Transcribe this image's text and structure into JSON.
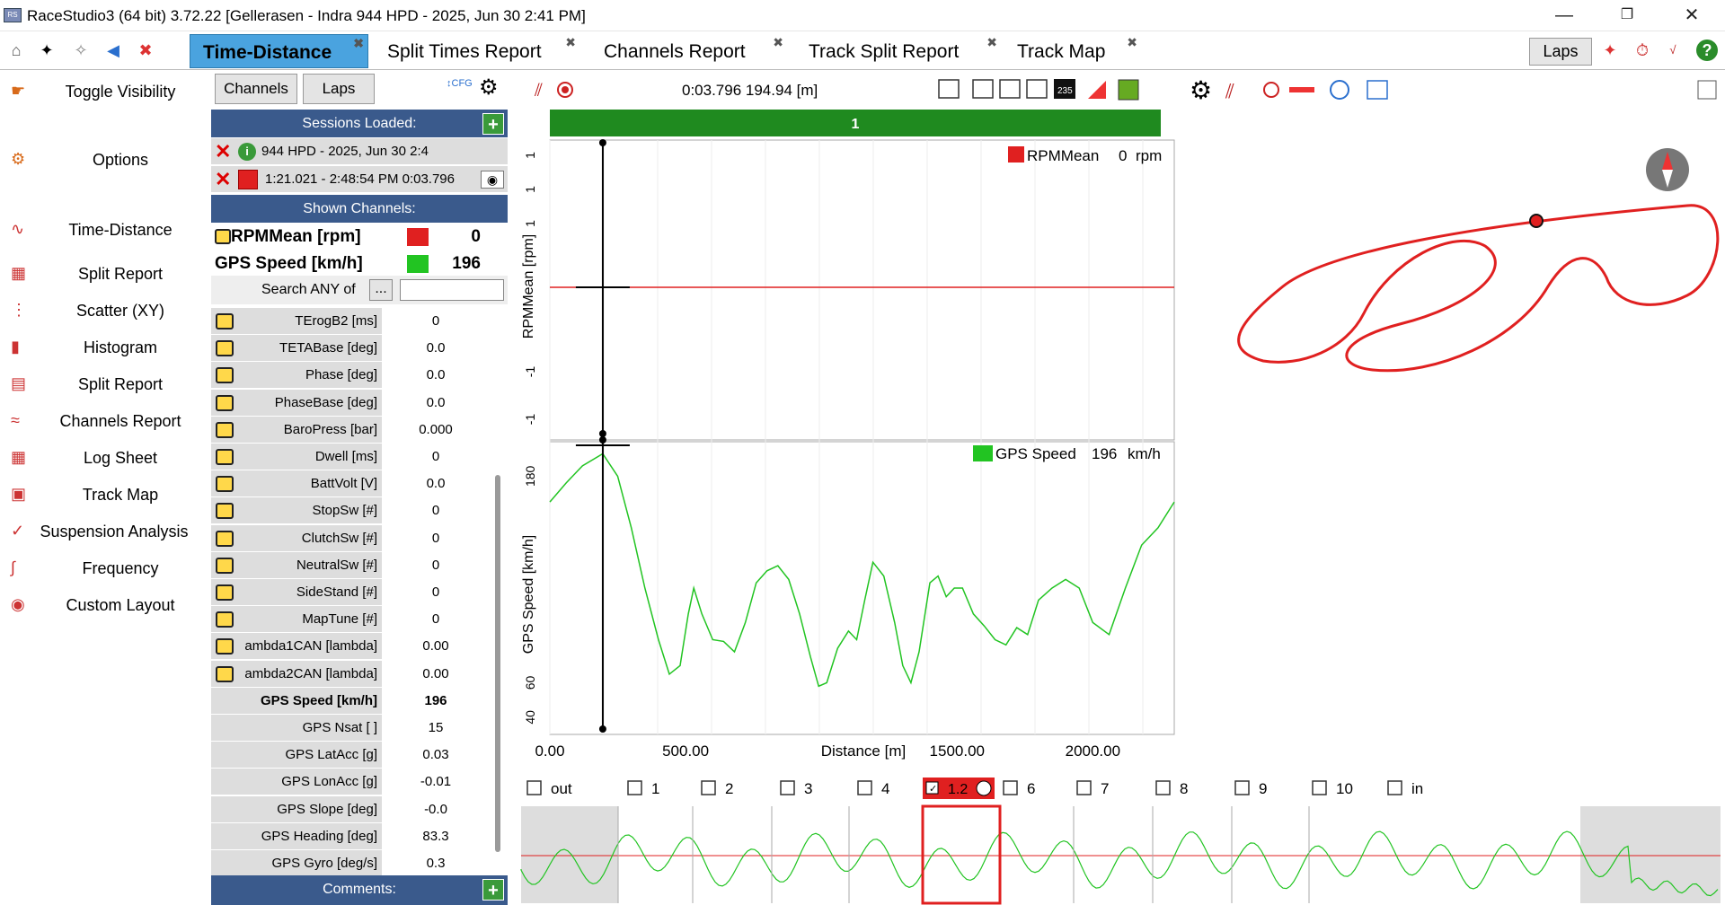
{
  "window": {
    "title": "RaceStudio3 (64 bit) 3.72.22 [Gellerasen - Indra 944 HPD - 2025, Jun 30 2:41 PM]"
  },
  "tabs": [
    {
      "label": "Time-Distance",
      "active": true
    },
    {
      "label": "Split Times Report"
    },
    {
      "label": "Channels Report"
    },
    {
      "label": "Track Split Report"
    },
    {
      "label": "Track Map"
    }
  ],
  "toolbar": {
    "laps_label": "Laps"
  },
  "nav": [
    {
      "label": "Toggle Visibility",
      "icon": "pointer-hand-icon"
    },
    {
      "label": "Options",
      "icon": "gears-icon"
    },
    {
      "label": "Time-Distance",
      "icon": "time-distance-icon"
    },
    {
      "label": "Split Report",
      "icon": "split-report-icon"
    },
    {
      "label": "Scatter (XY)",
      "icon": "scatter-icon"
    },
    {
      "label": "Histogram",
      "icon": "histogram-icon"
    },
    {
      "label": "Split Report",
      "icon": "split-report-2-icon"
    },
    {
      "label": "Channels Report",
      "icon": "channels-report-icon"
    },
    {
      "label": "Log Sheet",
      "icon": "log-sheet-icon"
    },
    {
      "label": "Track Map",
      "icon": "track-map-icon"
    },
    {
      "label": "Suspension Analysis",
      "icon": "suspension-icon"
    },
    {
      "label": "Frequency",
      "icon": "frequency-icon"
    },
    {
      "label": "Custom Layout",
      "icon": "custom-layout-icon"
    }
  ],
  "channels_panel": {
    "channels_btn": "Channels",
    "laps_btn": "Laps",
    "sessions_header": "Sessions Loaded:",
    "session_name": "944 HPD - 2025, Jun 30 2:4",
    "session_lap": "1:21.021 - 2:48:54 PM 0:03.796",
    "shown_header": "Shown Channels:",
    "shown": [
      {
        "name": "RPMMean [rpm]",
        "value": "0",
        "color": "#e02020"
      },
      {
        "name": "GPS Speed [km/h]",
        "value": "196",
        "color": "#22c422"
      }
    ],
    "search_label": "Search ANY of",
    "search_btn": "...",
    "search_value": "",
    "rows": [
      {
        "name": "TErogB2 [ms]",
        "value": "0",
        "note": true
      },
      {
        "name": "TETABase [deg]",
        "value": "0.0",
        "note": true
      },
      {
        "name": "Phase [deg]",
        "value": "0.0",
        "note": true
      },
      {
        "name": "PhaseBase [deg]",
        "value": "0.0",
        "note": true
      },
      {
        "name": "BaroPress [bar]",
        "value": "0.000",
        "note": true
      },
      {
        "name": "Dwell [ms]",
        "value": "0",
        "note": true
      },
      {
        "name": "BattVolt [V]",
        "value": "0.0",
        "note": true
      },
      {
        "name": "StopSw [#]",
        "value": "0",
        "note": true
      },
      {
        "name": "ClutchSw [#]",
        "value": "0",
        "note": true
      },
      {
        "name": "NeutralSw [#]",
        "value": "0",
        "note": true
      },
      {
        "name": "SideStand [#]",
        "value": "0",
        "note": true
      },
      {
        "name": "MapTune [#]",
        "value": "0",
        "note": true
      },
      {
        "name": "ambda1CAN [lambda]",
        "value": "0.00",
        "note": true
      },
      {
        "name": "ambda2CAN [lambda]",
        "value": "0.00",
        "note": true
      },
      {
        "name": "GPS Speed [km/h]",
        "value": "196",
        "note": false,
        "bold": true
      },
      {
        "name": "GPS Nsat [ ]",
        "value": "15",
        "note": false
      },
      {
        "name": "GPS LatAcc [g]",
        "value": "0.03",
        "note": false
      },
      {
        "name": "GPS LonAcc [g]",
        "value": "-0.01",
        "note": false
      },
      {
        "name": "GPS Slope [deg]",
        "value": "-0.0",
        "note": false
      },
      {
        "name": "GPS Heading [deg]",
        "value": "83.3",
        "note": false
      },
      {
        "name": "GPS Gyro [deg/s]",
        "value": "0.3",
        "note": false
      }
    ],
    "comments_header": "Comments:"
  },
  "plot": {
    "cursor_readout": "0:03.796 194.94 [m]",
    "lap_bar_label": "1",
    "top_legend": {
      "name": "RPMMean",
      "value": "0",
      "unit": "rpm",
      "color": "#e02020"
    },
    "bottom_legend": {
      "name": "GPS Speed",
      "value": "196",
      "unit": "km/h",
      "color": "#22c422"
    },
    "top_ylabel": "RPMMean [rpm]",
    "bottom_ylabel": "GPS Speed [km/h]",
    "xlabel": "Distance [m]",
    "top_ticks": [
      "1",
      "1",
      "1",
      "-1",
      "-1"
    ],
    "bottom_ticks": [
      "180",
      "60",
      "40"
    ],
    "x_ticks": [
      "0.00",
      "500.00",
      "1500.00",
      "2000.00"
    ],
    "icon_235": "235"
  },
  "chart_data": {
    "type": "line",
    "xlabel": "Distance [m]",
    "ylabel": "GPS Speed [km/h]",
    "xlim": [
      0,
      2300
    ],
    "ylim": [
      30,
      200
    ],
    "cursor_x": 195,
    "x": [
      0,
      60,
      120,
      195,
      250,
      300,
      350,
      400,
      440,
      480,
      510,
      530,
      560,
      600,
      640,
      680,
      720,
      760,
      800,
      840,
      880,
      920,
      960,
      990,
      1020,
      1060,
      1100,
      1130,
      1160,
      1190,
      1230,
      1270,
      1300,
      1330,
      1360,
      1400,
      1430,
      1460,
      1490,
      1520,
      1560,
      1600,
      1640,
      1680,
      1720,
      1760,
      1800,
      1850,
      1900,
      1950,
      2000,
      2060,
      2120,
      2180,
      2240,
      2300
    ],
    "series": [
      {
        "name": "GPS Speed",
        "values": [
          165,
          176,
          186,
          193,
          180,
          150,
          115,
          85,
          65,
          70,
          100,
          115,
          100,
          85,
          84,
          78,
          95,
          118,
          125,
          128,
          120,
          100,
          75,
          58,
          60,
          80,
          90,
          85,
          108,
          130,
          122,
          95,
          70,
          60,
          78,
          118,
          122,
          110,
          115,
          115,
          100,
          93,
          85,
          82,
          92,
          88,
          108,
          115,
          120,
          115,
          95,
          88,
          115,
          140,
          150,
          165
        ]
      }
    ],
    "legend": [
      "GPS Speed 196 km/h"
    ]
  },
  "track_map": {
    "color": "#e02020"
  },
  "laps_strip": {
    "laps": [
      "out",
      "1",
      "2",
      "3",
      "4",
      "1.2",
      "6",
      "7",
      "8",
      "9",
      "10",
      "in"
    ],
    "selected_index": 5
  }
}
